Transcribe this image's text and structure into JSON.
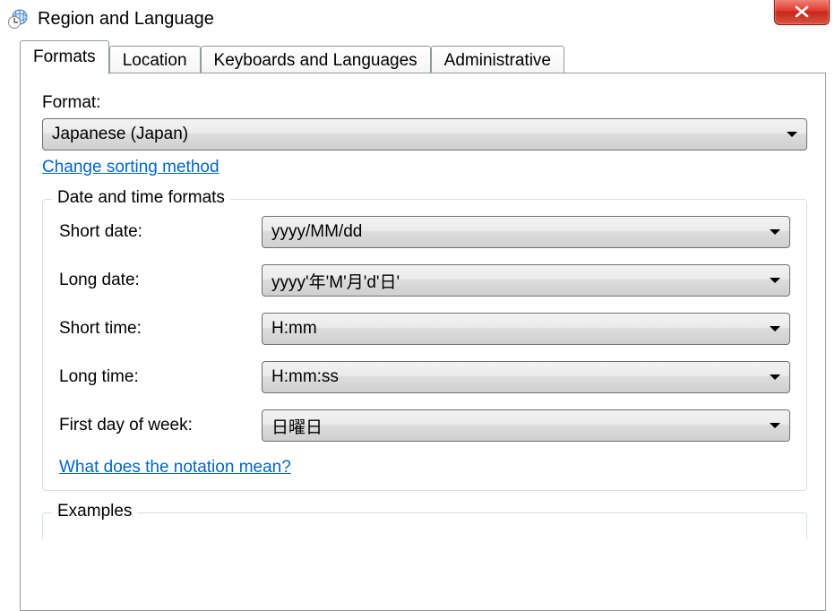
{
  "window": {
    "title": "Region and Language"
  },
  "tabs": [
    {
      "label": "Formats",
      "active": true
    },
    {
      "label": "Location",
      "active": false
    },
    {
      "label": "Keyboards and Languages",
      "active": false
    },
    {
      "label": "Administrative",
      "active": false
    }
  ],
  "format": {
    "label": "Format:",
    "value": "Japanese (Japan)",
    "sort_link": "Change sorting method"
  },
  "datetime": {
    "legend": "Date and time formats",
    "rows": [
      {
        "label": "Short date:",
        "value": "yyyy/MM/dd"
      },
      {
        "label": "Long date:",
        "value": "yyyy'年'M'月'd'日'"
      },
      {
        "label": "Short time:",
        "value": "H:mm"
      },
      {
        "label": "Long time:",
        "value": "H:mm:ss"
      },
      {
        "label": "First day of week:",
        "value": "日曜日"
      }
    ],
    "notation_link": "What does the notation mean?"
  },
  "examples": {
    "legend": "Examples"
  }
}
